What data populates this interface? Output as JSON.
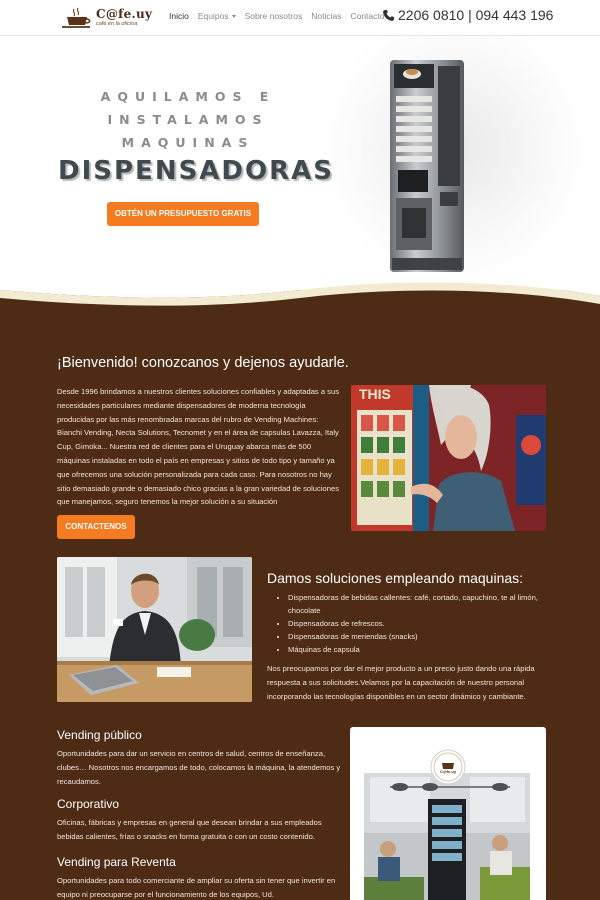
{
  "navbar": {
    "logo_text": "C@fe.uy",
    "logo_tagline": "café en la oficina",
    "links": [
      "Inicio",
      "Equipos",
      "Sobre nosotros",
      "Noticias",
      "Contacto"
    ],
    "phone": "2206 0810 | 094 443 196"
  },
  "hero": {
    "line1": "AQUILAMOS E",
    "line2": "INSTALAMOS",
    "line3": "MAQUINAS",
    "headline": "DISPENSADORAS",
    "cta": "OBTÉN UN PRESUPUESTO GRATIS"
  },
  "welcome": {
    "title": "¡Bienvenido! conozcanos y dejenos ayudarle.",
    "body": "Desde 1996 brindamos a nuestros clientes soluciones confiables y adaptadas a sus necesidades particulares mediante dispensadores de moderna tecnología producidas por las más renombradas marcas del rubro de Vending Machines: Bianchi Vending, Necta Solutions, Tecnomet y en el área de capsulas Lavazza, Italy Cup, Gimoka... Nuestra red de clientes para el Uruguay abarca más de 500 máquinas instaladas en todo el país en empresas y sitios de todo tipo y tamaño ya que ofrecemos una solución personalizada para cada caso. Para nosotros no hay sitio demasiado grande o demasiado chico gracias a la gran variedad de soluciones que manejamos, seguro tenemos la mejor solución a su situación",
    "cta": "CONTACTENOS"
  },
  "solutions": {
    "title": "Damos soluciones empleando maquinas:",
    "items": [
      "Dispensadoras de bebidas callentes: café, cortado, capuchino, te al limón, chocolate",
      "Dispensadoras de refrescos.",
      "Dispensadoras de meriendas (snacks)",
      "Máquinas de capsula"
    ],
    "body": "Nos preocupamos por dar el mejor producto a un precio justo dando una rápida respuesta a sus solicitudes.Velamos por la capacitación de nuestro personal incorporando las tecnologías disponibles en un sector dinámico y cambiante."
  },
  "services": [
    {
      "title": "Vending público",
      "body": "Oportunidades para dar un servicio en centros de salud, centros de enseñanza, clubes… Nosotros nos encargamos de todo, colocamos la máquina, la atendemos y recaudamos."
    },
    {
      "title": "Corporativo",
      "body": "Oficinas, fábricas y empresas en general que desean brindar a sus empleados bebidas calientes, frías o snacks en forma gratuita o con un costo contenido."
    },
    {
      "title": "Vending para Reventa",
      "body": "Oportunidades para todo comerciante de ampliar su oferta sin tener que invertir en equipo ni preocuparse por el funcionamiento de los equipos, Ud."
    }
  ],
  "card": {
    "badge_text": "C@fe.uy"
  },
  "colors": {
    "brown": "#4e2b14",
    "orange": "#f47b20",
    "cream": "#f3ead2"
  }
}
